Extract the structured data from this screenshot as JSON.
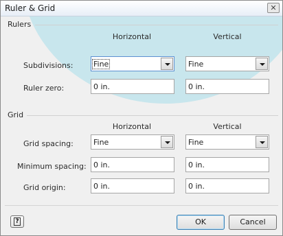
{
  "window": {
    "title": "Ruler & Grid",
    "close_glyph": "✕"
  },
  "rulers": {
    "section_label": "Rulers",
    "col_horizontal": "Horizontal",
    "col_vertical": "Vertical",
    "subdivisions": {
      "label": "Subdivisions:",
      "horizontal": "Fine",
      "vertical": "Fine"
    },
    "ruler_zero": {
      "label": "Ruler zero:",
      "horizontal": "0 in.",
      "vertical": "0 in."
    }
  },
  "grid": {
    "section_label": "Grid",
    "col_horizontal": "Horizontal",
    "col_vertical": "Vertical",
    "grid_spacing": {
      "label": "Grid spacing:",
      "horizontal": "Fine",
      "vertical": "Fine"
    },
    "minimum_spacing": {
      "label": "Minimum spacing:",
      "horizontal": "0 in.",
      "vertical": "0 in."
    },
    "grid_origin": {
      "label": "Grid origin:",
      "horizontal": "0 in.",
      "vertical": "0 in."
    }
  },
  "buttons": {
    "help_glyph": "?",
    "ok": "OK",
    "cancel": "Cancel"
  },
  "icons": {
    "close": "close-icon",
    "help": "help-icon",
    "dropdown": "chevron-down-icon"
  }
}
